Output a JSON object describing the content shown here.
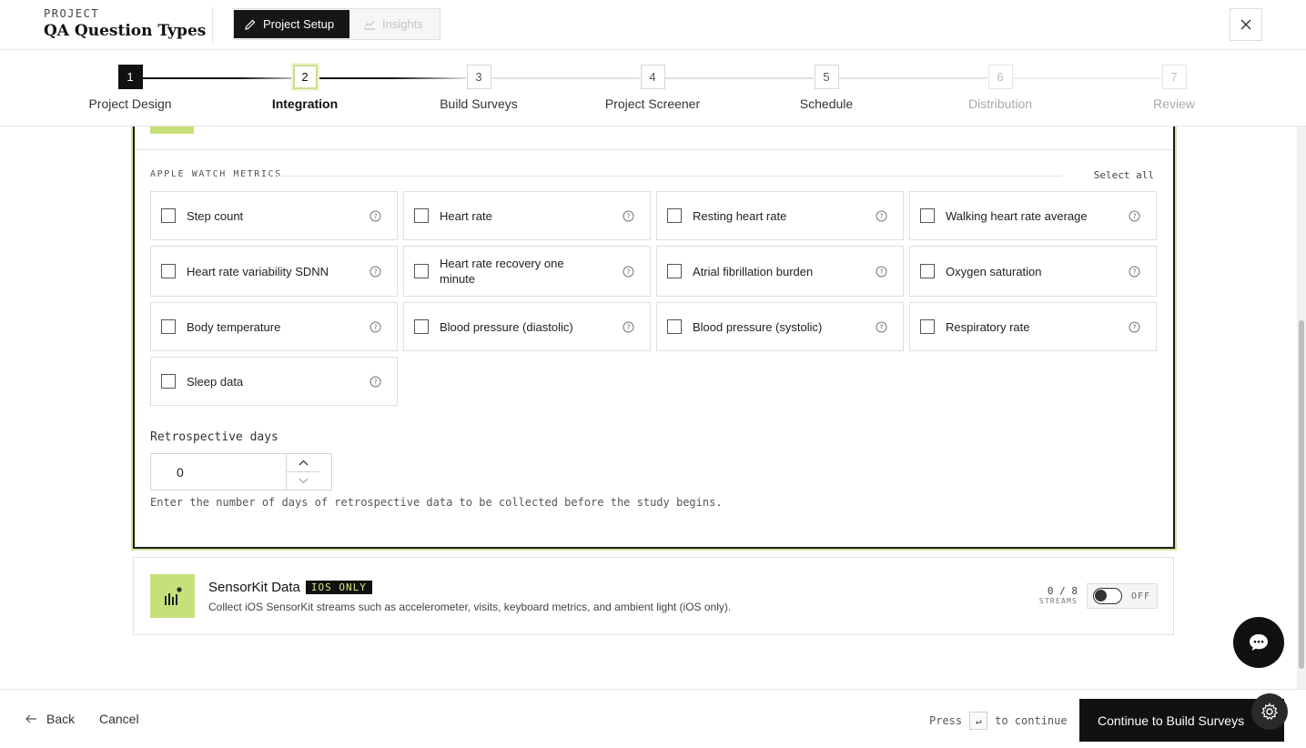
{
  "header": {
    "kicker": "PROJECT",
    "title": "QA Question Types",
    "modes": [
      {
        "label": "Project Setup",
        "icon": "pencil-icon",
        "active": true
      },
      {
        "label": "Insights",
        "icon": "chart-icon",
        "active": false
      }
    ],
    "close_icon": "close-icon"
  },
  "stepper": {
    "steps": [
      {
        "number": "1",
        "label": "Project Design",
        "state": "done"
      },
      {
        "number": "2",
        "label": "Integration",
        "state": "current"
      },
      {
        "number": "3",
        "label": "Build Surveys",
        "state": "upcoming"
      },
      {
        "number": "4",
        "label": "Project Screener",
        "state": "upcoming"
      },
      {
        "number": "5",
        "label": "Schedule",
        "state": "upcoming"
      },
      {
        "number": "6",
        "label": "Distribution",
        "state": "locked"
      },
      {
        "number": "7",
        "label": "Review",
        "state": "locked"
      }
    ]
  },
  "apple_watch": {
    "section_label": "APPLE WATCH METRICS",
    "select_all_label": "Select all",
    "metrics": [
      {
        "label": "Step count",
        "checked": false
      },
      {
        "label": "Heart rate",
        "checked": false
      },
      {
        "label": "Resting heart rate",
        "checked": false
      },
      {
        "label": "Walking heart rate average",
        "checked": false
      },
      {
        "label": "Heart rate variability SDNN",
        "checked": false
      },
      {
        "label": "Heart rate recovery one minute",
        "checked": false
      },
      {
        "label": "Atrial fibrillation burden",
        "checked": false
      },
      {
        "label": "Oxygen saturation",
        "checked": false
      },
      {
        "label": "Body temperature",
        "checked": false
      },
      {
        "label": "Blood pressure (diastolic)",
        "checked": false
      },
      {
        "label": "Blood pressure (systolic)",
        "checked": false
      },
      {
        "label": "Respiratory rate",
        "checked": false
      },
      {
        "label": "Sleep data",
        "checked": false
      }
    ],
    "retro_label": "Retrospective days",
    "retro_value": "0",
    "retro_help": "Enter the number of days of retrospective data to be collected before the study begins."
  },
  "sensorkit": {
    "title": "SensorKit Data",
    "badge": "IOS ONLY",
    "description": "Collect iOS SensorKit streams such as accelerometer, visits, keyboard metrics, and ambient light (iOS only).",
    "streams_count": "0 / 8",
    "streams_unit": "STREAMS",
    "toggle_label": "OFF",
    "enabled": false
  },
  "footer": {
    "back_label": "Back",
    "cancel_label": "Cancel",
    "press_label": "Press",
    "key_glyph": "↵",
    "continue_hint": "to continue",
    "continue_label": "Continue to Build Surveys"
  },
  "colors": {
    "accent": "#c6e07a",
    "dark": "#111111"
  }
}
